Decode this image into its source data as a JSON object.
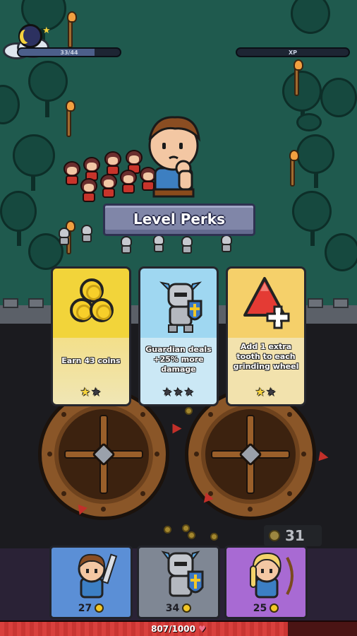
{
  "top_bar": {
    "night_progress_text": "33/44",
    "night_progress": 0.75,
    "xp_label": "XP",
    "xp_progress": 0.0
  },
  "modal": {
    "title": "Level Perks",
    "cards": [
      {
        "name": "coins",
        "description": "Earn 43 coins",
        "stars_filled": 1,
        "stars_total": 2,
        "icon": "coin-stack-icon"
      },
      {
        "name": "guardian",
        "description": "Guardian deals +25% more damage",
        "stars_filled": 0,
        "stars_total": 3,
        "icon": "guardian-knight-icon"
      },
      {
        "name": "tooth",
        "description": "Add 1 extra tooth to each grinding wheel",
        "stars_filled": 1,
        "stars_total": 2,
        "icon": "red-tooth-plus-icon"
      }
    ]
  },
  "coins": {
    "count": "31"
  },
  "heroes": [
    {
      "name": "Swordsman",
      "cost": "27",
      "color": "#5b8fd6",
      "icon": "swordsman-icon"
    },
    {
      "name": "Guardian",
      "cost": "34",
      "color": "#7f8794",
      "icon": "guardian-knight-icon"
    },
    {
      "name": "Archer",
      "cost": "25",
      "color": "#a86ad3",
      "icon": "archer-icon"
    }
  ],
  "health": {
    "text": "807/1000",
    "current": 807,
    "max": 1000
  },
  "colors": {
    "forest": "#1f5a4e",
    "accent_gold": "#f6d33c",
    "health_red": "#d9403d",
    "banner": "#8086a8"
  }
}
